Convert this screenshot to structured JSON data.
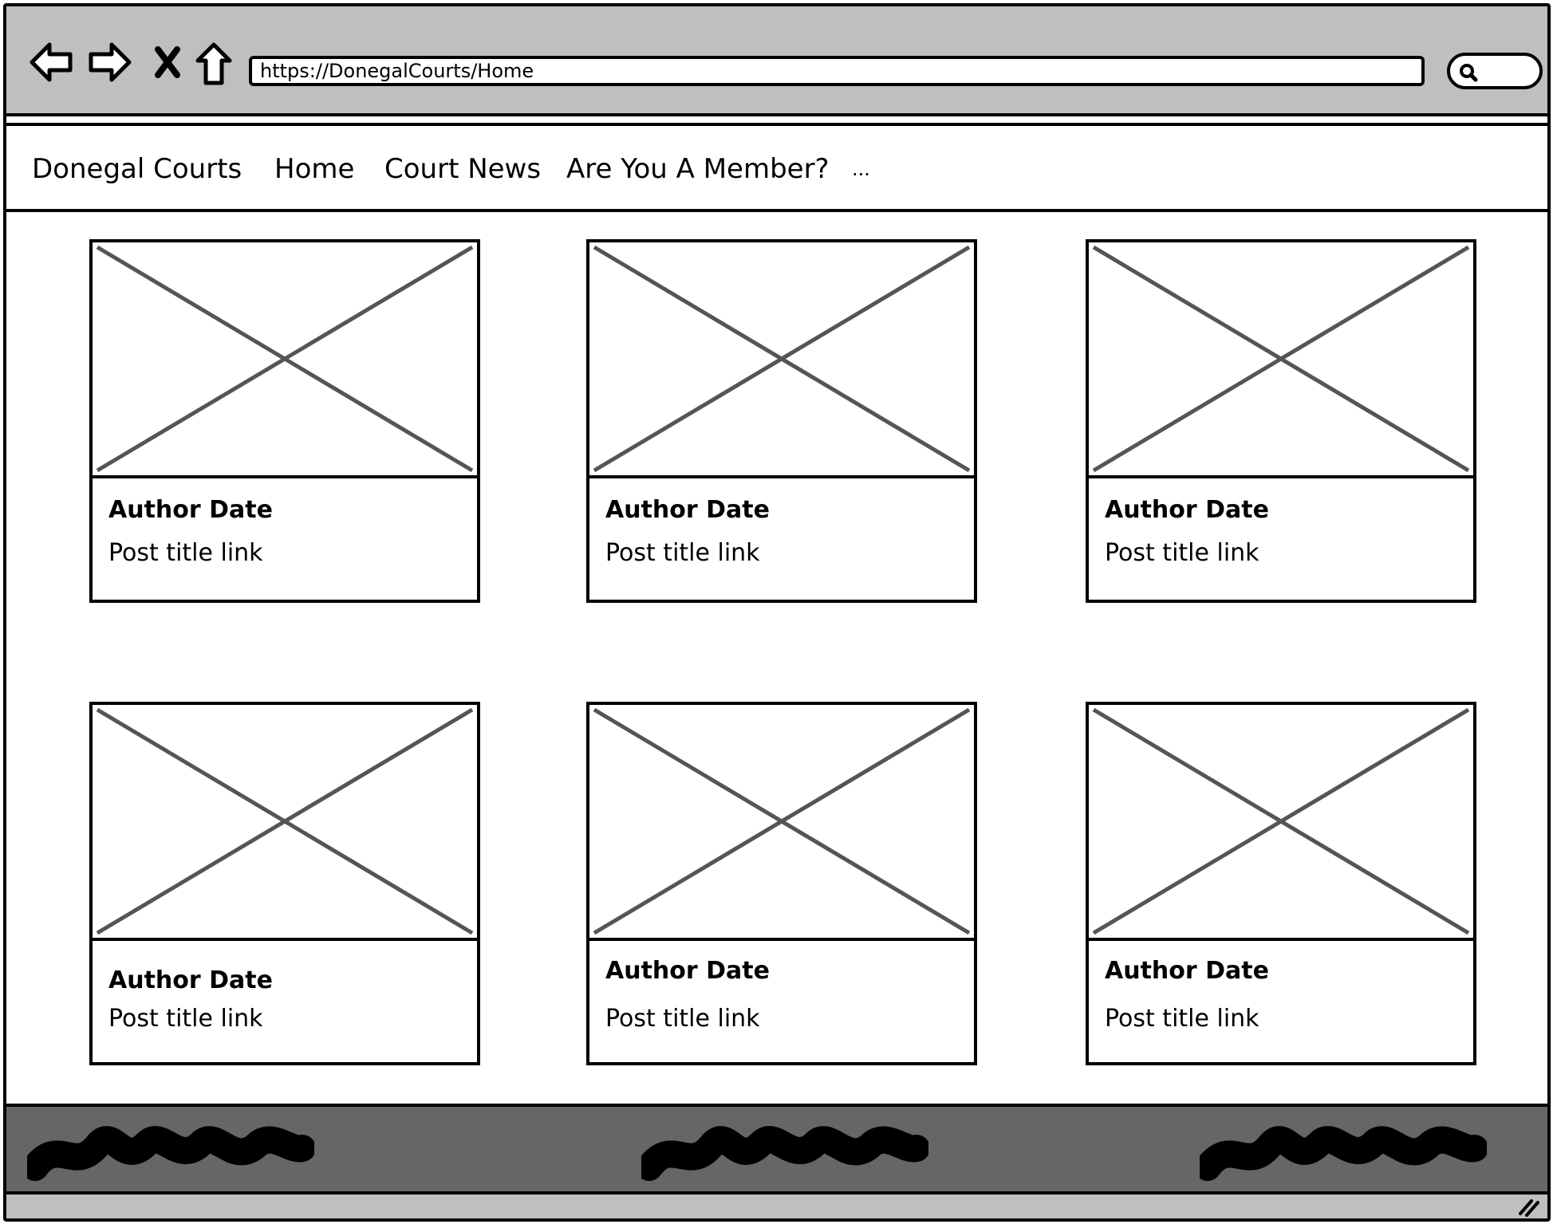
{
  "browser": {
    "url": "https://DonegalCourts/Home",
    "icons": [
      "back-arrow-icon",
      "forward-arrow-icon",
      "close-icon",
      "home-icon",
      "search-icon"
    ]
  },
  "navbar": {
    "brand": "Donegal Courts",
    "items": [
      {
        "label": "Home"
      },
      {
        "label": "Court News"
      },
      {
        "label": "Are You A Member?"
      },
      {
        "label": "..."
      }
    ]
  },
  "posts": [
    {
      "meta": "Author Date",
      "title": "Post title link"
    },
    {
      "meta": "Author Date",
      "title": "Post title link"
    },
    {
      "meta": "Author Date",
      "title": "Post title link"
    },
    {
      "meta": "Author Date",
      "title": "Post title link"
    },
    {
      "meta": "Author Date",
      "title": "Post title link"
    },
    {
      "meta": "Author Date",
      "title": "Post title link"
    }
  ],
  "colors": {
    "chrome": "#bfbfbf",
    "footer": "#666666",
    "placeholder_cross": "#555555"
  }
}
